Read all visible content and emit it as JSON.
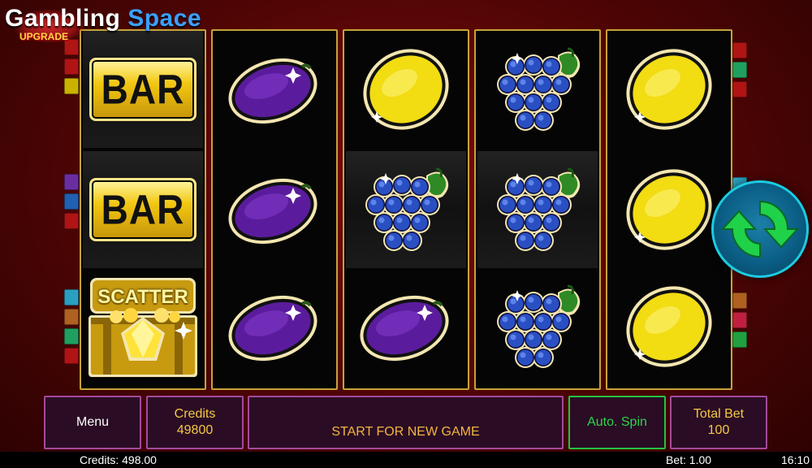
{
  "logo": {
    "title_part1": "Gambling",
    "title_part2": "Space",
    "badge": "UPGRADE"
  },
  "colors": {
    "paylines_left": [
      "#b01414",
      "#b01414",
      "#c9b200",
      "#6a2ea0",
      "#2060b0",
      "#b01414",
      "#2aa0c0",
      "#b06020",
      "#20a060",
      "#b01414"
    ],
    "paylines_right": [
      "#b01414",
      "#20a060",
      "#b01414",
      "#2aa0c0",
      "#b01414",
      "#6a2ea0",
      "#b06020",
      "#c02040",
      "#20a040"
    ],
    "accent_border": "#a44a9b",
    "auto_spin_border": "#26c044"
  },
  "reels": [
    {
      "symbols": [
        "bar",
        "bar",
        "scatter"
      ]
    },
    {
      "symbols": [
        "plum",
        "plum",
        "plum"
      ]
    },
    {
      "symbols": [
        "lemon",
        "grapes",
        "plum"
      ]
    },
    {
      "symbols": [
        "grapes",
        "grapes",
        "grapes"
      ]
    },
    {
      "symbols": [
        "lemon",
        "lemon",
        "lemon"
      ]
    }
  ],
  "symbol_labels": {
    "bar": "BAR",
    "scatter": "SCATTER"
  },
  "spin_button": {
    "icon": "refresh-icon"
  },
  "buttons": {
    "menu": "Menu",
    "credits_label": "Credits",
    "credits_value": "49800",
    "start": "START FOR NEW GAME",
    "auto_spin": "Auto. Spin",
    "total_bet_label": "Total Bet",
    "total_bet_value": "100"
  },
  "status": {
    "credits": "Credits: 498.00",
    "bet": "Bet: 1.00",
    "time": "16:10"
  }
}
